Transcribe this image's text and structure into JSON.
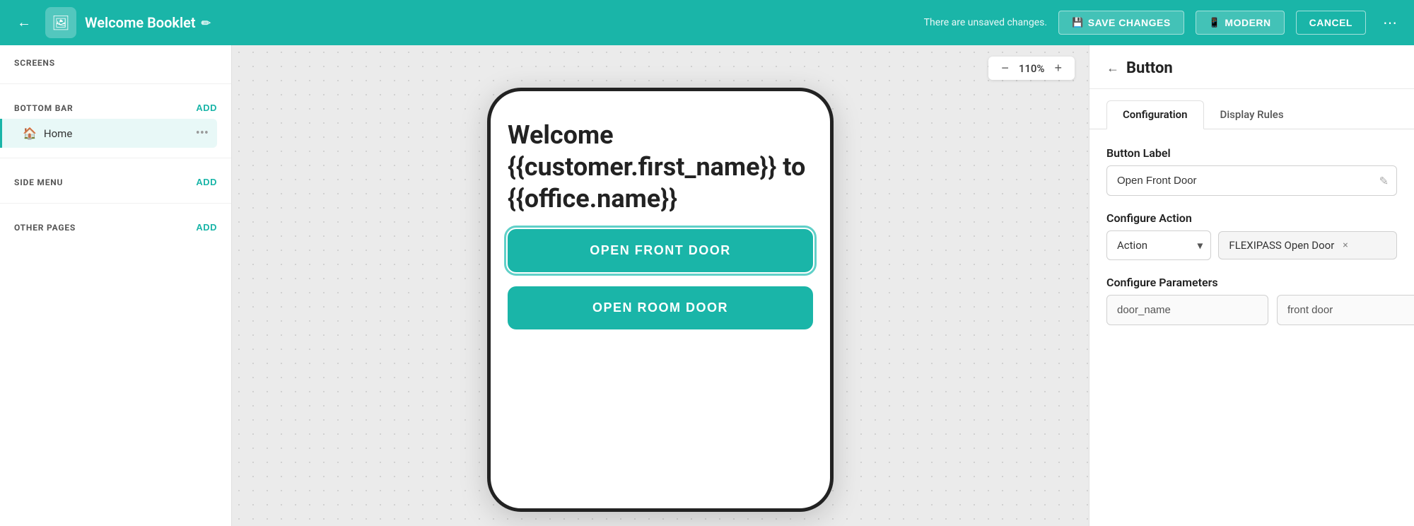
{
  "topbar": {
    "back_icon": "←",
    "app_icon": "🖼",
    "title": "Welcome Booklet",
    "edit_icon": "✏",
    "unsaved_message": "There are unsaved changes.",
    "save_label": "SAVE CHANGES",
    "save_icon": "💾",
    "view_label": "MODERN",
    "view_icon": "📱",
    "cancel_label": "CANCEL",
    "more_icon": "⋯"
  },
  "sidebar": {
    "screens_label": "SCREENS",
    "bottom_bar_label": "BOTTOM BAR",
    "bottom_bar_add": "ADD",
    "home_label": "Home",
    "home_icon": "🏠",
    "side_menu_label": "SIDE MENU",
    "side_menu_add": "ADD",
    "other_pages_label": "OTHER PAGES",
    "other_pages_add": "ADD"
  },
  "canvas": {
    "zoom_minus": "−",
    "zoom_level": "110%",
    "zoom_plus": "+"
  },
  "phone": {
    "welcome_text": "Welcome {{customer.first_name}} to {{office.name}}",
    "btn1_label": "OPEN FRONT DOOR",
    "btn2_label": "OPEN ROOM DOOR"
  },
  "panel": {
    "back_icon": "←",
    "title": "Button",
    "tab_config": "Configuration",
    "tab_display": "Display Rules",
    "button_label_field": "Button Label",
    "button_label_value": "Open Front Door",
    "button_label_icon": "✎",
    "configure_action_label": "Configure Action",
    "action_select_value": "Action",
    "action_tag_value": "FLEXIPASS Open Door",
    "action_tag_close": "×",
    "configure_params_label": "Configure Parameters",
    "param_key": "door_name",
    "param_value": "front door"
  }
}
